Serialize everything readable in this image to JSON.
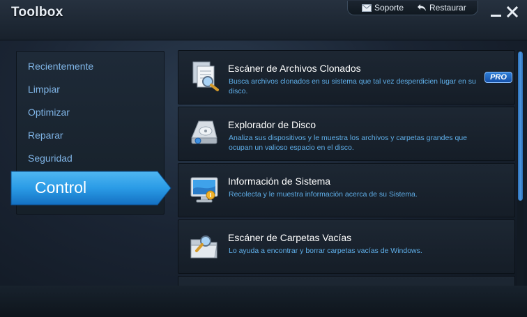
{
  "window": {
    "title": "Toolbox",
    "support_label": "Soporte",
    "restore_label": "Restaurar"
  },
  "sidebar": {
    "items": [
      {
        "label": "Recientemente"
      },
      {
        "label": "Limpiar"
      },
      {
        "label": "Optimizar"
      },
      {
        "label": "Reparar"
      },
      {
        "label": "Seguridad"
      }
    ],
    "active": {
      "label": "Control"
    }
  },
  "tools": [
    {
      "title": "Escáner de Archivos Clonados",
      "description": "Busca archivos clonados en su sistema que tal vez desperdicien lugar en su disco.",
      "badge": "PRO",
      "icon": "duplicate-files-icon"
    },
    {
      "title": "Explorador de Disco",
      "description": "Analiza sus dispositivos y le muestra los archivos y carpetas grandes que ocupan un valioso espacio en el disco.",
      "icon": "disk-explorer-icon"
    },
    {
      "title": "Información de Sistema",
      "description": "Recolecta y le muestra información acerca de su Sistema.",
      "icon": "system-info-icon"
    },
    {
      "title": "Escáner de Carpetas Vacías",
      "description": "Lo ayuda a encontrar y borrar carpetas vacías de Windows.",
      "icon": "empty-folder-scanner-icon"
    }
  ],
  "colors": {
    "accent": "#2a9be6",
    "link_text": "#7fb4e6",
    "description_text": "#5faee8"
  }
}
